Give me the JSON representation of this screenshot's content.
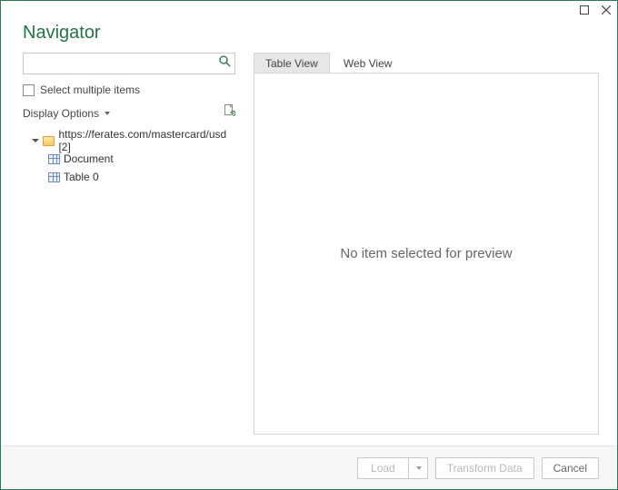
{
  "window": {
    "title": "Navigator"
  },
  "left": {
    "search_placeholder": "",
    "select_multiple_label": "Select multiple items",
    "display_options_label": "Display Options",
    "tree": {
      "root_label": "https://ferates.com/mastercard/usd [2]",
      "items": [
        {
          "label": "Document"
        },
        {
          "label": "Table 0"
        }
      ]
    }
  },
  "right": {
    "tabs": {
      "table_view": "Table View",
      "web_view": "Web View"
    },
    "preview_empty_message": "No item selected for preview"
  },
  "footer": {
    "load_label": "Load",
    "transform_label": "Transform Data",
    "cancel_label": "Cancel"
  }
}
